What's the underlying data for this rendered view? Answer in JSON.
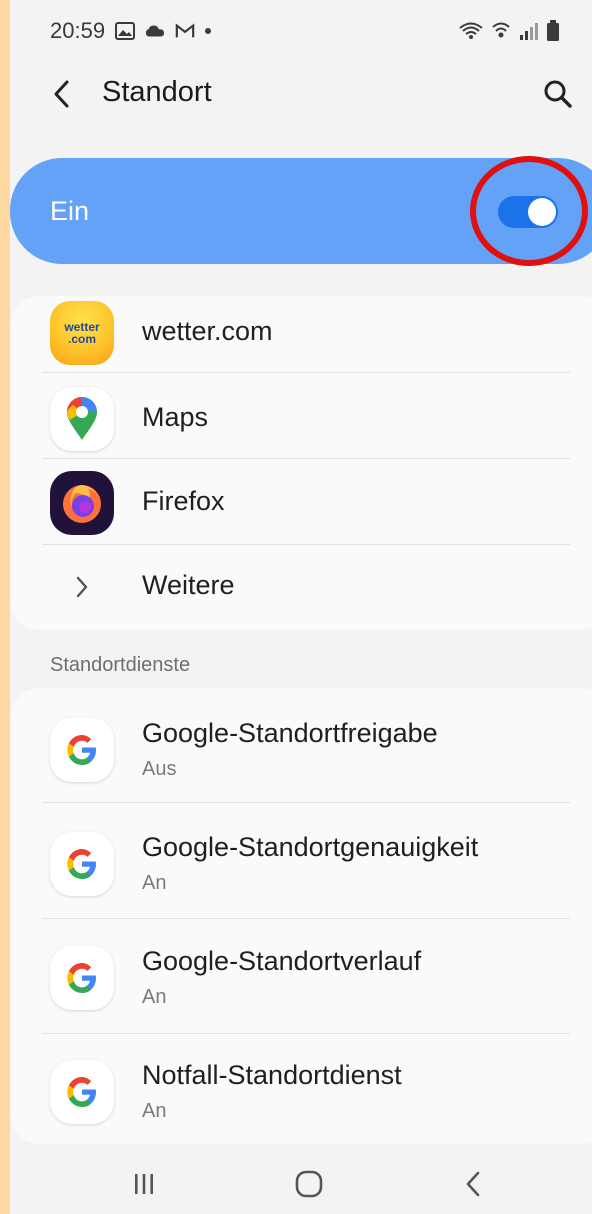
{
  "status": {
    "time": "20:59"
  },
  "header": {
    "title": "Standort"
  },
  "master": {
    "label": "Ein",
    "enabled": true,
    "accent": "#64a2f8"
  },
  "apps": [
    {
      "label": "wetter.com",
      "icon": "wetter-icon",
      "icon_text": [
        "wetter",
        ".com"
      ]
    },
    {
      "label": "Maps",
      "icon": "maps-icon"
    },
    {
      "label": "Firefox",
      "icon": "firefox-icon"
    },
    {
      "label": "Weitere",
      "icon": "chevron-right-icon"
    }
  ],
  "services": {
    "header": "Standortdienste",
    "items": [
      {
        "label": "Google-Standortfreigabe",
        "status": "Aus"
      },
      {
        "label": "Google-Standortgenauigkeit",
        "status": "An"
      },
      {
        "label": "Google-Standortverlauf",
        "status": "An"
      },
      {
        "label": "Notfall-Standortdienst",
        "status": "An"
      }
    ]
  },
  "colors": {
    "highlight": "#e01010",
    "switch_on": "#1a73e8"
  }
}
